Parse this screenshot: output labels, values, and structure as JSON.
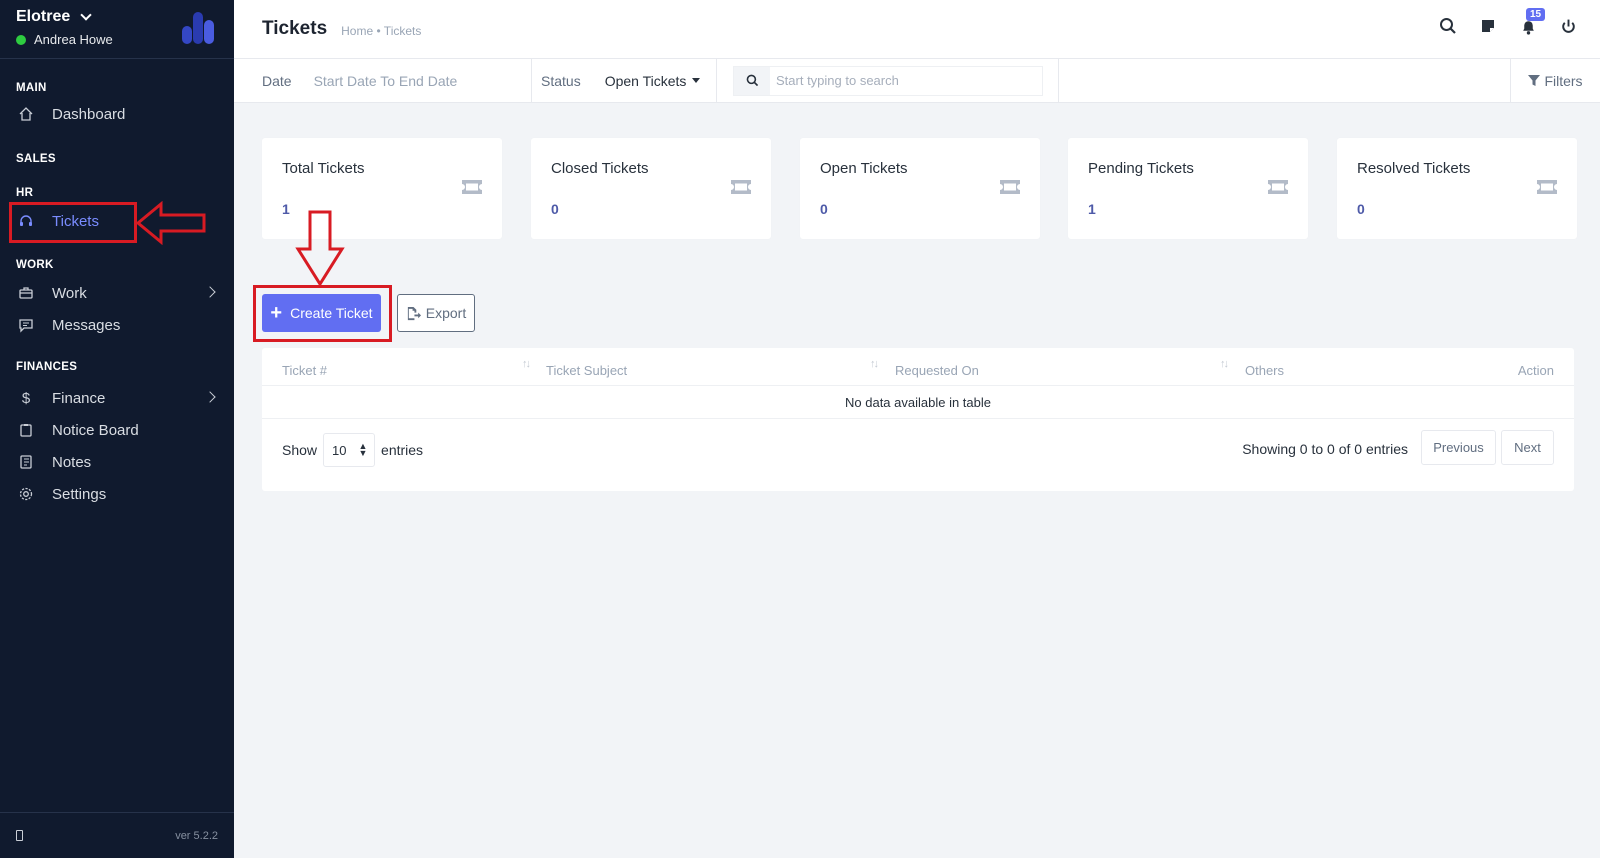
{
  "sidebar": {
    "company": "Elotree",
    "user": "Andrea Howe",
    "version": "ver 5.2.2",
    "sections": {
      "main": "MAIN",
      "sales": "SALES",
      "hr": "HR",
      "work": "WORK",
      "finances": "FINANCES"
    },
    "items": {
      "dashboard": "Dashboard",
      "tickets": "Tickets",
      "work": "Work",
      "messages": "Messages",
      "finance": "Finance",
      "notice_board": "Notice Board",
      "notes": "Notes",
      "settings": "Settings"
    }
  },
  "header": {
    "title": "Tickets",
    "breadcrumb": "Home • Tickets",
    "notification_count": "15"
  },
  "filters": {
    "date_label": "Date",
    "date_value": "Start Date To End Date",
    "status_label": "Status",
    "status_value": "Open Tickets",
    "search_placeholder": "Start typing to search",
    "filters_label": "Filters"
  },
  "cards": [
    {
      "title": "Total Tickets",
      "value": "1"
    },
    {
      "title": "Closed Tickets",
      "value": "0"
    },
    {
      "title": "Open Tickets",
      "value": "0"
    },
    {
      "title": "Pending Tickets",
      "value": "1"
    },
    {
      "title": "Resolved Tickets",
      "value": "0"
    }
  ],
  "actions": {
    "create": "Create Ticket",
    "export": "Export"
  },
  "table": {
    "columns": [
      "Ticket #",
      "Ticket Subject",
      "Requested On",
      "Others",
      "Action"
    ],
    "empty": "No data available in table",
    "show_label": "Show",
    "page_length": "10",
    "entries_label": "entries",
    "showing": "Showing 0 to 0 of 0 entries",
    "previous": "Previous",
    "next": "Next"
  },
  "colors": {
    "sidebar_bg": "#101a2e",
    "accent": "#616ef2",
    "annotation": "#d81b23"
  }
}
